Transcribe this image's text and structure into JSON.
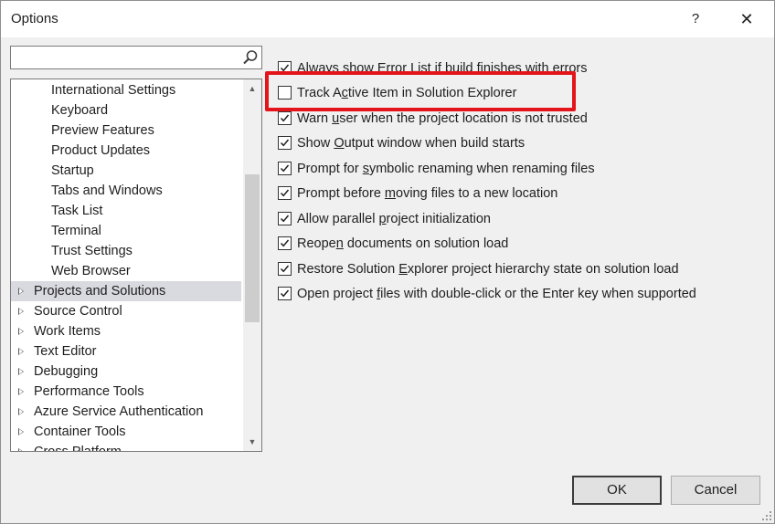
{
  "dialog": {
    "title": "Options",
    "help_label": "?",
    "close_label": "✕"
  },
  "search": {
    "value": "",
    "placeholder": ""
  },
  "tree": {
    "items": [
      {
        "label": "International Settings",
        "level": "child"
      },
      {
        "label": "Keyboard",
        "level": "child"
      },
      {
        "label": "Preview Features",
        "level": "child"
      },
      {
        "label": "Product Updates",
        "level": "child"
      },
      {
        "label": "Startup",
        "level": "child"
      },
      {
        "label": "Tabs and Windows",
        "level": "child"
      },
      {
        "label": "Task List",
        "level": "child"
      },
      {
        "label": "Terminal",
        "level": "child"
      },
      {
        "label": "Trust Settings",
        "level": "child"
      },
      {
        "label": "Web Browser",
        "level": "child"
      },
      {
        "label": "Projects and Solutions",
        "level": "parent",
        "selected": true
      },
      {
        "label": "Source Control",
        "level": "parent"
      },
      {
        "label": "Work Items",
        "level": "parent"
      },
      {
        "label": "Text Editor",
        "level": "parent"
      },
      {
        "label": "Debugging",
        "level": "parent"
      },
      {
        "label": "Performance Tools",
        "level": "parent"
      },
      {
        "label": "Azure Service Authentication",
        "level": "parent"
      },
      {
        "label": "Container Tools",
        "level": "parent"
      },
      {
        "label": "Cross Platform",
        "level": "parent"
      }
    ]
  },
  "options": [
    {
      "pre": "Always show Error List if build finishes with errors",
      "key": "",
      "post": "",
      "checked": true
    },
    {
      "pre": "Track A",
      "key": "c",
      "post": "tive Item in Solution Explorer",
      "checked": false
    },
    {
      "pre": "Warn ",
      "key": "u",
      "post": "ser when the project location is not trusted",
      "checked": true
    },
    {
      "pre": "Show ",
      "key": "O",
      "post": "utput window when build starts",
      "checked": true
    },
    {
      "pre": "Prompt for ",
      "key": "s",
      "post": "ymbolic renaming when renaming files",
      "checked": true
    },
    {
      "pre": "Prompt before ",
      "key": "m",
      "post": "oving files to a new location",
      "checked": true
    },
    {
      "pre": "Allow parallel ",
      "key": "p",
      "post": "roject initialization",
      "checked": true
    },
    {
      "pre": "Reope",
      "key": "n",
      "post": " documents on solution load",
      "checked": true
    },
    {
      "pre": "Restore Solution ",
      "key": "E",
      "post": "xplorer project hierarchy state on solution load",
      "checked": true
    },
    {
      "pre": "Open project ",
      "key": "f",
      "post": "iles with double-click or the Enter key when supported",
      "checked": true
    }
  ],
  "buttons": {
    "ok_label": "OK",
    "cancel_label": "Cancel"
  },
  "colors": {
    "highlight": "#e4141b",
    "selected_row": "#d9d9e0"
  }
}
